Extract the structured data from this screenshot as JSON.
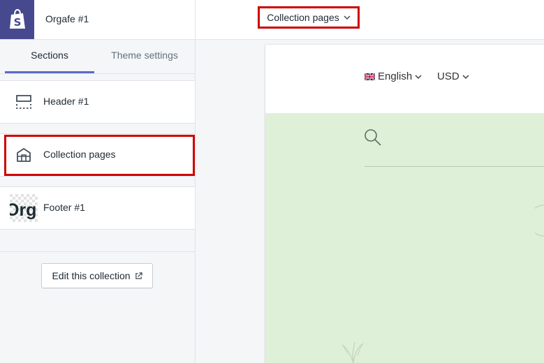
{
  "store": {
    "name": "Orgafe #1"
  },
  "tabs": {
    "sections": "Sections",
    "theme_settings": "Theme settings"
  },
  "sections": [
    {
      "label": "Header #1",
      "icon": "header-layout-icon"
    },
    {
      "label": "Collection pages",
      "icon": "collection-page-icon"
    },
    {
      "label": "Footer #1",
      "icon": "footer-logo-thumbnail",
      "thumb_text": "Org"
    }
  ],
  "edit_button": {
    "label": "Edit this collection",
    "icon": "external-link-icon"
  },
  "page_selector": {
    "label": "Collection pages",
    "icon": "chevron-down-icon"
  },
  "preview": {
    "language": "English",
    "currency": "USD"
  },
  "colors": {
    "brand": "#47498f",
    "highlight": "#cc0000",
    "tab_indicator": "#5c6ac4",
    "preview_bg": "#dff0d8"
  }
}
